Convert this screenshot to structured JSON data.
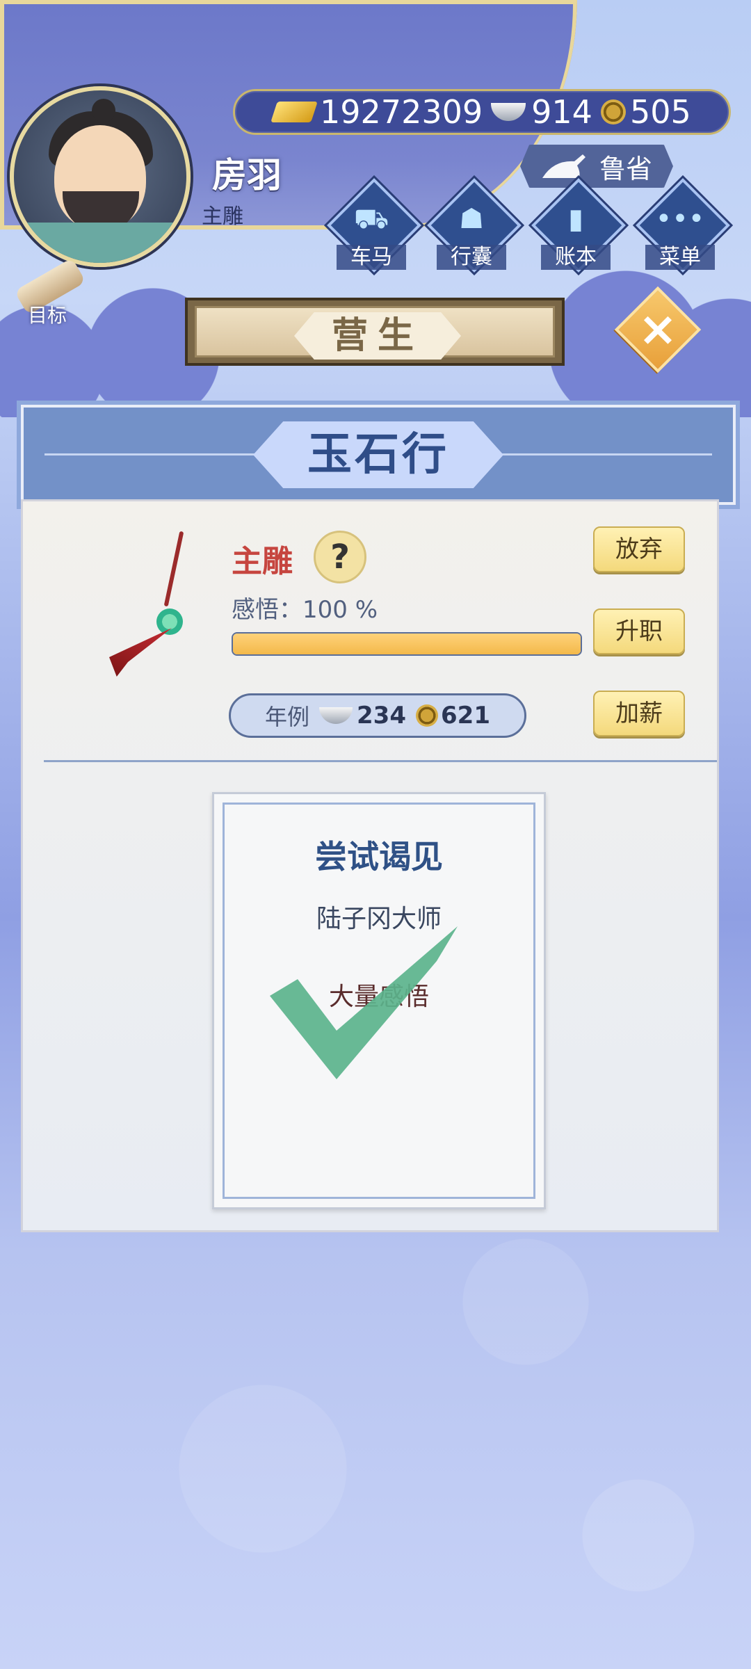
{
  "player": {
    "name": "房羽",
    "title": "主雕"
  },
  "currency": [
    {
      "icon": "gold-ingot-icon",
      "value": "19272309"
    },
    {
      "icon": "silver-ingot-icon",
      "value": "914"
    },
    {
      "icon": "copper-coin-icon",
      "value": "505"
    }
  ],
  "region": "鲁省",
  "top_menu": [
    {
      "label": "车马",
      "icon": "carriage-icon"
    },
    {
      "label": "行囊",
      "icon": "bundle-icon"
    },
    {
      "label": "账本",
      "icon": "ledger-icon"
    },
    {
      "label": "菜单",
      "icon": "menu-icon"
    }
  ],
  "goal_label": "目标",
  "section_title": "营生",
  "shop_name": "玉石行",
  "job": {
    "name": "主雕",
    "insight_label": "感悟：100 %",
    "insight_progress": 1.0,
    "salary_label": "年例",
    "salary_silver": "234",
    "salary_copper": "621"
  },
  "actions": {
    "abandon": "放弃",
    "promote": "升职",
    "raise": "加薪"
  },
  "card": {
    "title": "尝试谒见",
    "target": "陆子冈大师",
    "reward": "大量感悟",
    "completed": true
  },
  "colors": {
    "accent_blue": "#2f5186",
    "gold_button": "#f4d97c",
    "job_red": "#c6453f",
    "check_green": "#5bb38c"
  }
}
